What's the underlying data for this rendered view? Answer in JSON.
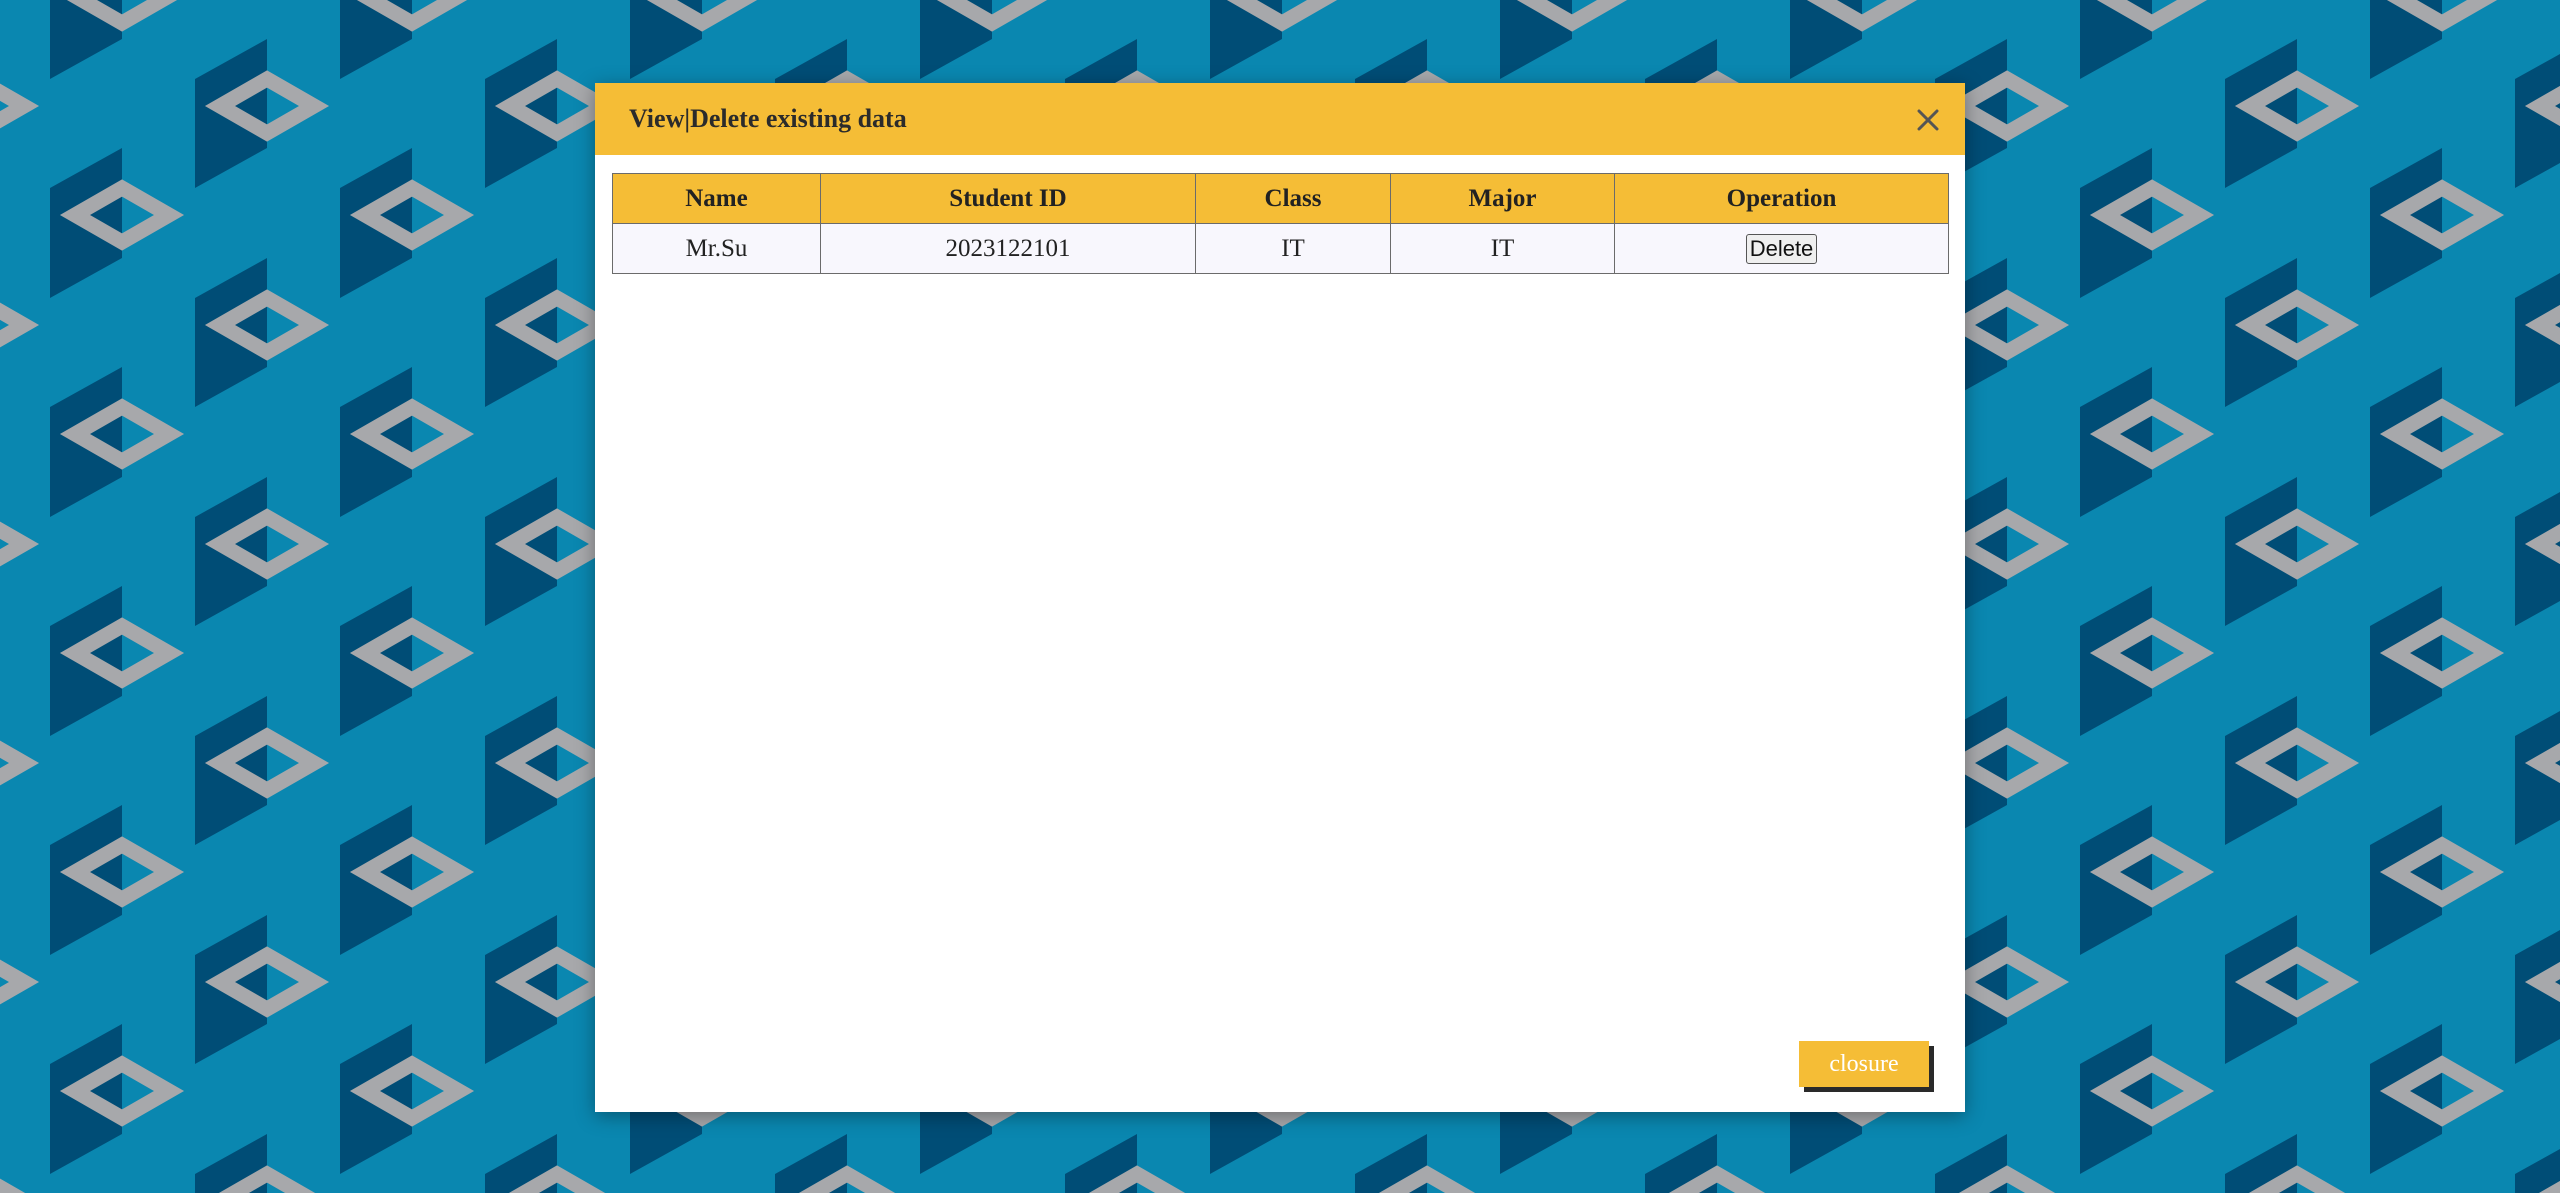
{
  "colors": {
    "accent": "#f5bd36",
    "background_light": "#0a87b0",
    "background_dark": "#004d76",
    "pattern_gray": "#a7a8ab",
    "row_background": "#f8f7fd"
  },
  "modal": {
    "title": "View|Delete existing data",
    "close_icon": "close-icon"
  },
  "table": {
    "headers": [
      "Name",
      "Student ID",
      "Class",
      "Major",
      "Operation"
    ],
    "rows": [
      {
        "name": "Mr.Su",
        "student_id": "2023122101",
        "class": "IT",
        "major": "IT",
        "operation_label": "Delete"
      }
    ]
  },
  "footer": {
    "closure_label": "closure"
  }
}
